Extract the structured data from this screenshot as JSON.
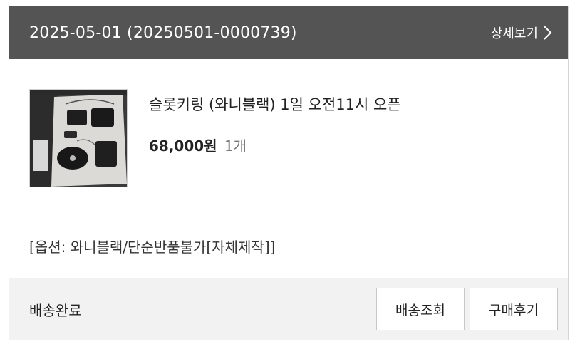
{
  "order": {
    "title": "2025-05-01 (20250501-0000739)",
    "detail_link": "상세보기"
  },
  "product": {
    "name": "슬롯키링 (와니블랙) 1일 오전11시 오픈",
    "price": "68,000원",
    "quantity": "1개",
    "option": "[옵션: 와니블랙/단순반품불가[자체제작]]"
  },
  "footer": {
    "status": "배송완료",
    "track_button": "배송조회",
    "review_button": "구매후기"
  },
  "colors": {
    "header_bg": "#545454",
    "footer_bg": "#f2f2f2",
    "border": "#d4d4d4"
  },
  "icons": {
    "detail_link_icon": "chevron-right-icon"
  }
}
